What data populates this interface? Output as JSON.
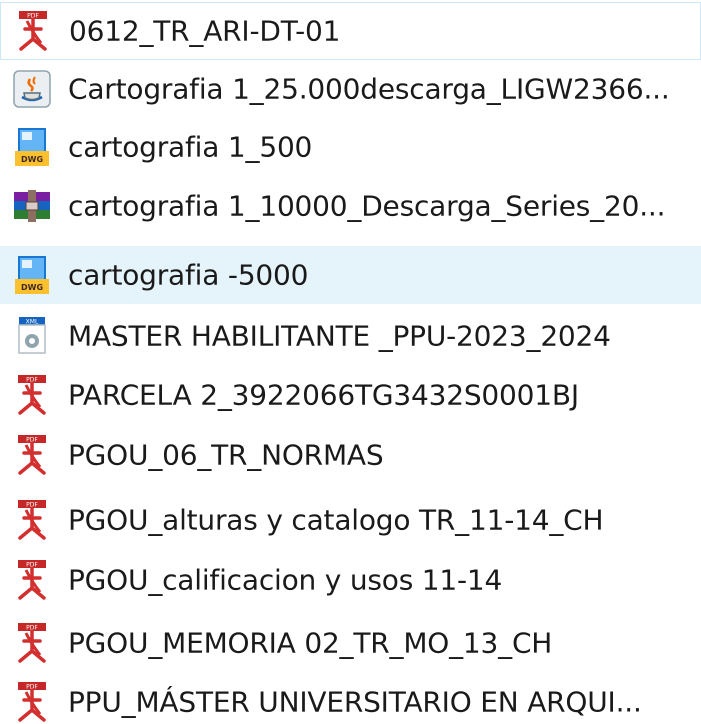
{
  "files": [
    {
      "name": "0612_TR_ARI-DT-01",
      "icon": "pdf-icon"
    },
    {
      "name": "Cartografia 1_25.000descarga_LIGW2366...",
      "icon": "java-icon"
    },
    {
      "name": "cartografia 1_500",
      "icon": "dwg-icon"
    },
    {
      "name": "cartografia 1_10000_Descarga_Series_20...",
      "icon": "winrar-archive-icon"
    },
    {
      "name": "cartografia -5000",
      "icon": "dwg-icon"
    },
    {
      "name": "MASTER HABILITANTE _PPU-2023_2024",
      "icon": "xml-document-icon"
    },
    {
      "name": "PARCELA 2_3922066TG3432S0001BJ",
      "icon": "pdf-icon"
    },
    {
      "name": "PGOU_06_TR_NORMAS",
      "icon": "pdf-icon"
    },
    {
      "name": "PGOU_alturas y catalogo TR_11-14_CH",
      "icon": "pdf-icon"
    },
    {
      "name": "PGOU_calificacion y usos 11-14",
      "icon": "pdf-icon"
    },
    {
      "name": "PGOU_MEMORIA 02_TR_MO_13_CH",
      "icon": "pdf-icon"
    },
    {
      "name": "PPU_MÁSTER UNIVERSITARIO EN ARQUI...",
      "icon": "pdf-icon"
    }
  ],
  "colors": {
    "hover_row": "#e5f3fb",
    "focus_border": "#cde8fb",
    "pdf_red": "#d32f2f"
  }
}
